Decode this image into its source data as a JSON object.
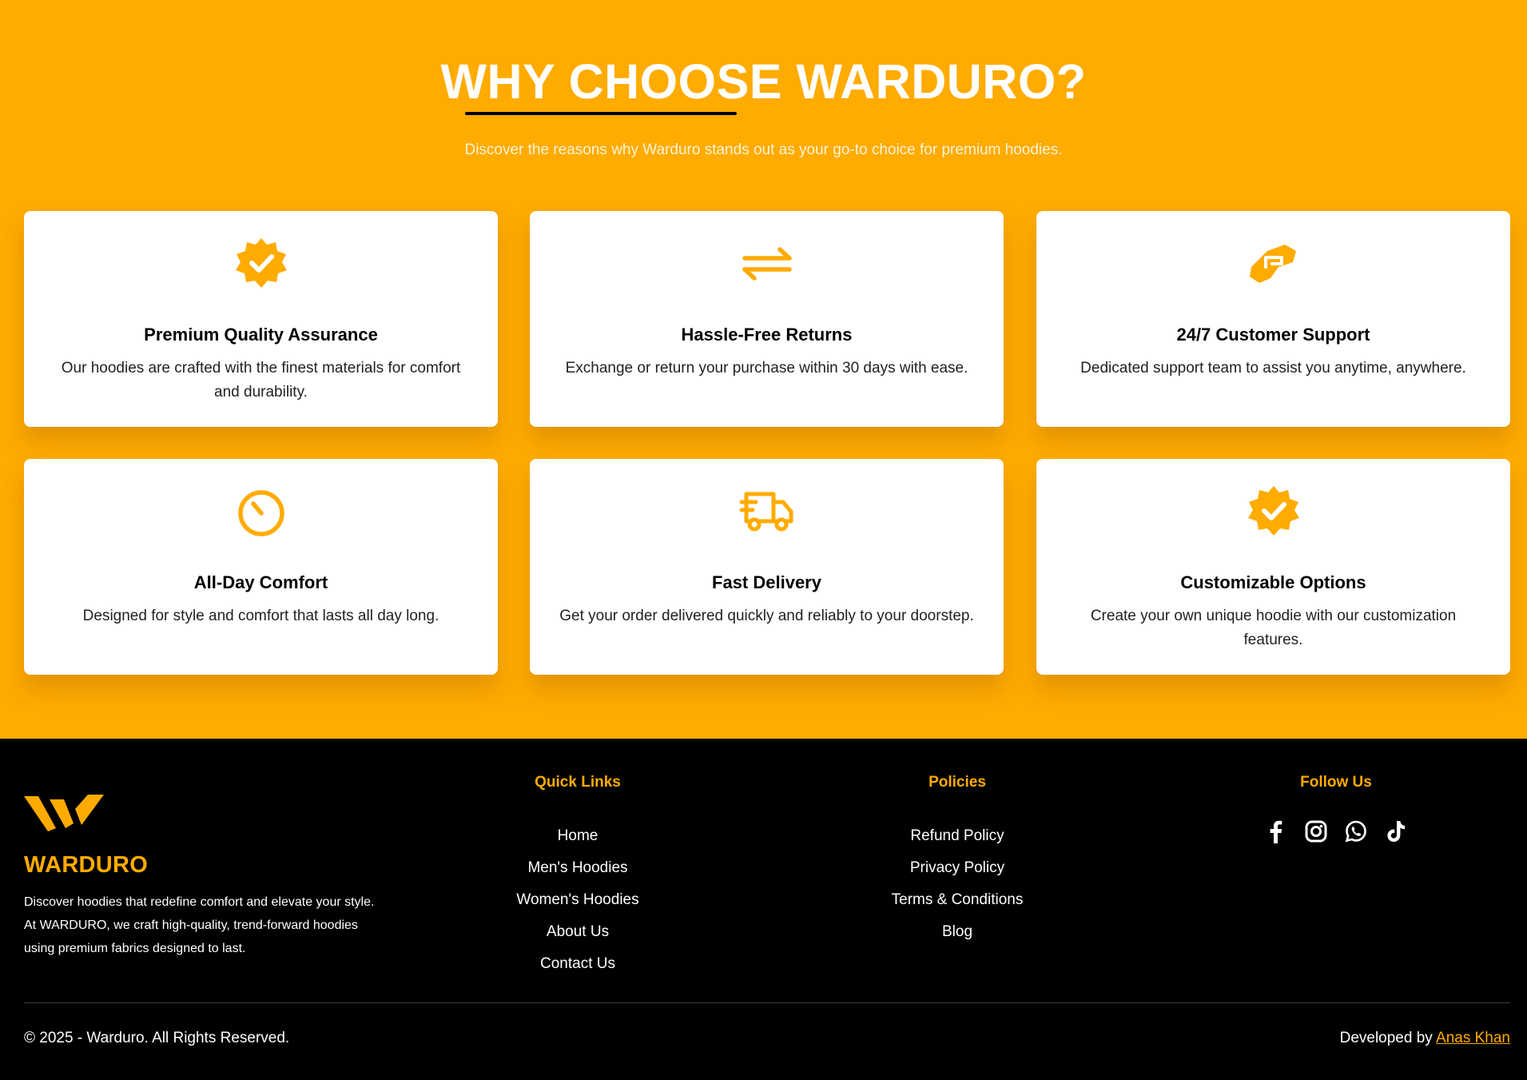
{
  "why": {
    "title": "WHY CHOOSE WARDURO?",
    "subtitle": "Discover the reasons why Warduro stands out as your go-to choice for premium hoodies.",
    "accent_color": "#ffab00",
    "cards": [
      {
        "icon": "badge-check-icon",
        "title": "Premium Quality Assurance",
        "desc": "Our hoodies are crafted with the finest materials for comfort and durability."
      },
      {
        "icon": "arrows-exchange-icon",
        "title": "Hassle-Free Returns",
        "desc": "Exchange or return your purchase within 30 days with ease."
      },
      {
        "icon": "handshake-icon",
        "title": "24/7 Customer Support",
        "desc": "Dedicated support team to assist you anytime, anywhere."
      },
      {
        "icon": "stopwatch-icon",
        "title": "All-Day Comfort",
        "desc": "Designed for style and comfort that lasts all day long."
      },
      {
        "icon": "delivery-truck-icon",
        "title": "Fast Delivery",
        "desc": "Get your order delivered quickly and reliably to your doorstep."
      },
      {
        "icon": "badge-check-icon",
        "title": "Customizable Options",
        "desc": "Create your own unique hoodie with our customization features."
      }
    ]
  },
  "footer": {
    "brand": {
      "logo_icon": "warduro-w-logo",
      "name": "WARDURO",
      "description": "Discover hoodies that redefine comfort and elevate your style. At WARDURO, we craft high-quality, trend-forward hoodies using premium fabrics designed to last."
    },
    "quick_links": {
      "heading": "Quick Links",
      "items": [
        "Home",
        "Men's Hoodies",
        "Women's Hoodies",
        "About Us",
        "Contact Us"
      ]
    },
    "policies": {
      "heading": "Policies",
      "items": [
        "Refund Policy",
        "Privacy Policy",
        "Terms & Conditions",
        "Blog"
      ]
    },
    "follow": {
      "heading": "Follow Us",
      "icons": [
        "facebook-icon",
        "instagram-icon",
        "whatsapp-icon",
        "tiktok-icon"
      ]
    },
    "copyright": "© 2025 - Warduro. All Rights Reserved.",
    "developed_by_label": "Developed by",
    "developer_name": "Anas Khan"
  }
}
